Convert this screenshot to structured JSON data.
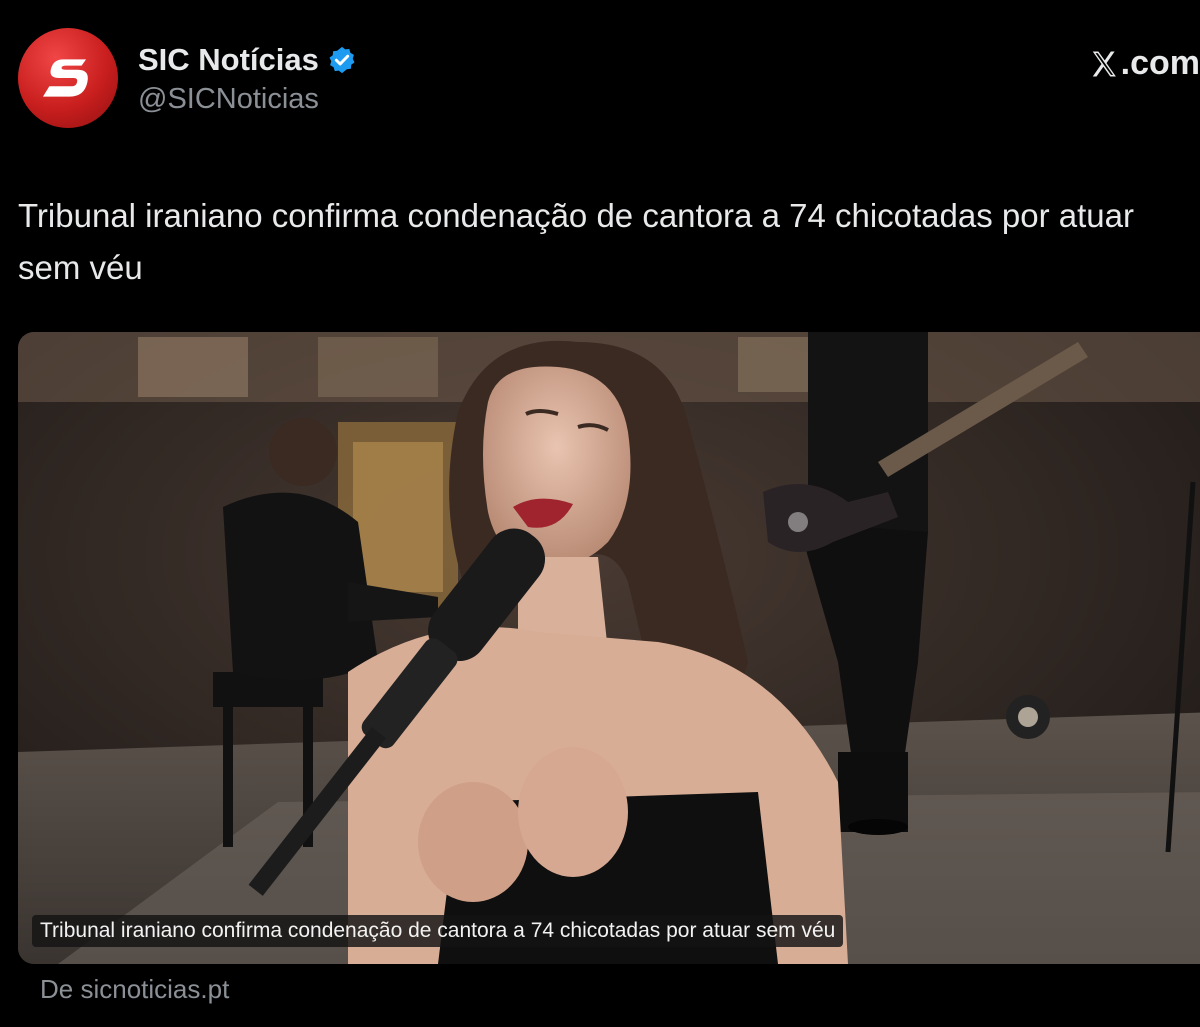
{
  "author": {
    "name": "SIC Notícias",
    "handle": "@SICNoticias",
    "verified": true,
    "avatar_icon": "sic-logo-icon",
    "avatar_color": "#d42424"
  },
  "brand": {
    "label": ".com",
    "icon": "x-logo-icon"
  },
  "post": {
    "text": "Tribunal iraniano confirma condenação de cantora a 74 chicotadas por atuar sem véu"
  },
  "media": {
    "caption": "Tribunal iraniano confirma condenação de cantora a 74 chicotadas por atuar sem véu",
    "source": "De sicnoticias.pt"
  },
  "colors": {
    "background": "#000000",
    "text_primary": "#e7e9ea",
    "text_secondary": "#8b9096",
    "verified_badge": "#1d9bf0"
  }
}
